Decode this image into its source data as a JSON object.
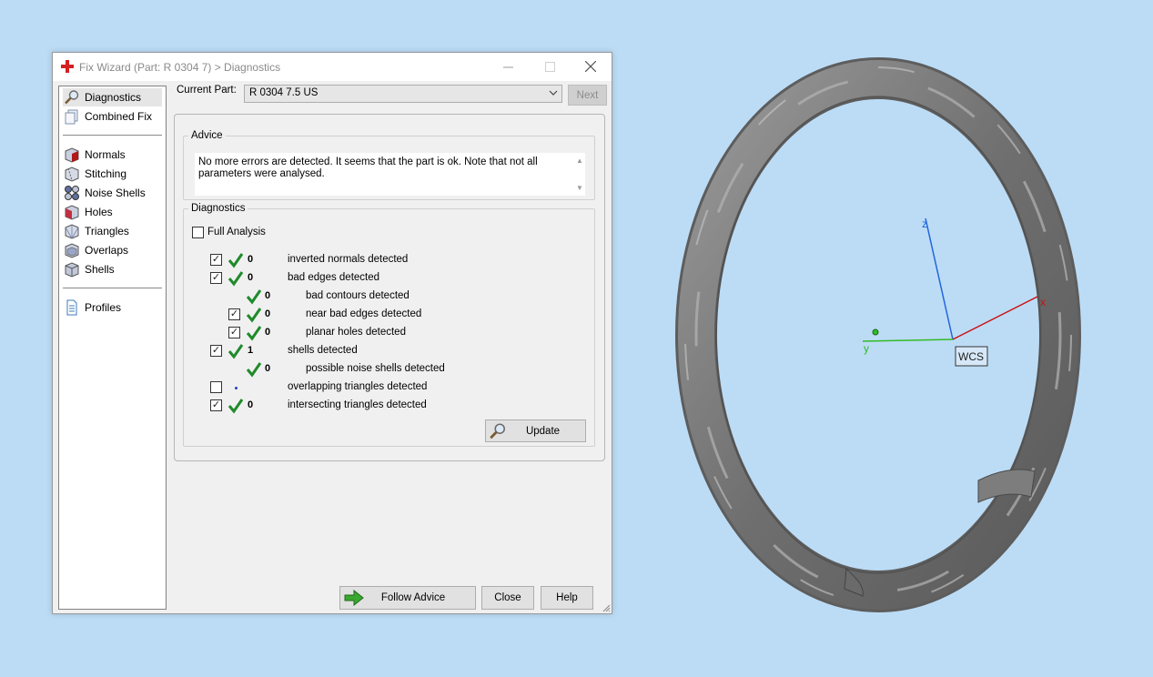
{
  "window": {
    "title": "Fix Wizard (Part: R 0304 7) > Diagnostics",
    "controls": {
      "minimize": "minimize",
      "maximize": "maximize",
      "close": "close"
    }
  },
  "sidebar": {
    "top_items": [
      {
        "label": "Diagnostics",
        "icon": "magnifier-icon",
        "selected": true
      },
      {
        "label": "Combined Fix",
        "icon": "pages-icon"
      }
    ],
    "fix_items": [
      {
        "label": "Normals",
        "icon": "cube-red-icon"
      },
      {
        "label": "Stitching",
        "icon": "stitch-cube-icon"
      },
      {
        "label": "Noise Shells",
        "icon": "noise-shells-icon"
      },
      {
        "label": "Holes",
        "icon": "cube-hole-icon"
      },
      {
        "label": "Triangles",
        "icon": "triangles-icon"
      },
      {
        "label": "Overlaps",
        "icon": "overlaps-icon"
      },
      {
        "label": "Shells",
        "icon": "shells-icon"
      }
    ],
    "bottom_items": [
      {
        "label": "Profiles",
        "icon": "document-icon"
      }
    ]
  },
  "part": {
    "label": "Current Part:",
    "value": "R 0304 7.5 US",
    "next_label": "Next"
  },
  "advice": {
    "title": "Advice",
    "text": "No more errors are detected. It seems that the part is ok. Note that not all parameters were analysed."
  },
  "diagnostics": {
    "title": "Diagnostics",
    "full_analysis_label": "Full Analysis",
    "full_analysis_checked": false,
    "rows": [
      {
        "checked": true,
        "ok": true,
        "count": "0",
        "label": "inverted normals detected"
      },
      {
        "checked": true,
        "ok": true,
        "count": "0",
        "label": "bad edges detected"
      },
      {
        "ok": true,
        "count": "0",
        "label": "bad contours detected"
      },
      {
        "checked": true,
        "ok": true,
        "count": "0",
        "label": "near bad edges detected"
      },
      {
        "checked": true,
        "ok": true,
        "count": "0",
        "label": "planar holes detected"
      },
      {
        "checked": true,
        "ok": true,
        "count": "1",
        "label": "shells detected"
      },
      {
        "ok": true,
        "count": "0",
        "label": "possible noise shells detected"
      },
      {
        "checked": false,
        "ok": false,
        "count": "",
        "label": "overlapping triangles detected"
      },
      {
        "checked": true,
        "ok": true,
        "count": "0",
        "label": "intersecting triangles detected"
      }
    ],
    "update_label": "Update"
  },
  "footer": {
    "follow_advice_label": "Follow Advice",
    "close_label": "Close",
    "help_label": "Help"
  },
  "viewport": {
    "axes": {
      "x": "x",
      "y": "y",
      "z": "z"
    },
    "wcs_label": "WCS",
    "colors": {
      "x": "#cc1111",
      "y": "#33bb22",
      "z": "#2266dd",
      "background": "#bcdcf6",
      "model": "#8a8a8a"
    }
  },
  "colors": {
    "check_green": "#1f8a2a",
    "app_icon_red": "#d42020",
    "follow_arrow_green": "#3aa830"
  }
}
